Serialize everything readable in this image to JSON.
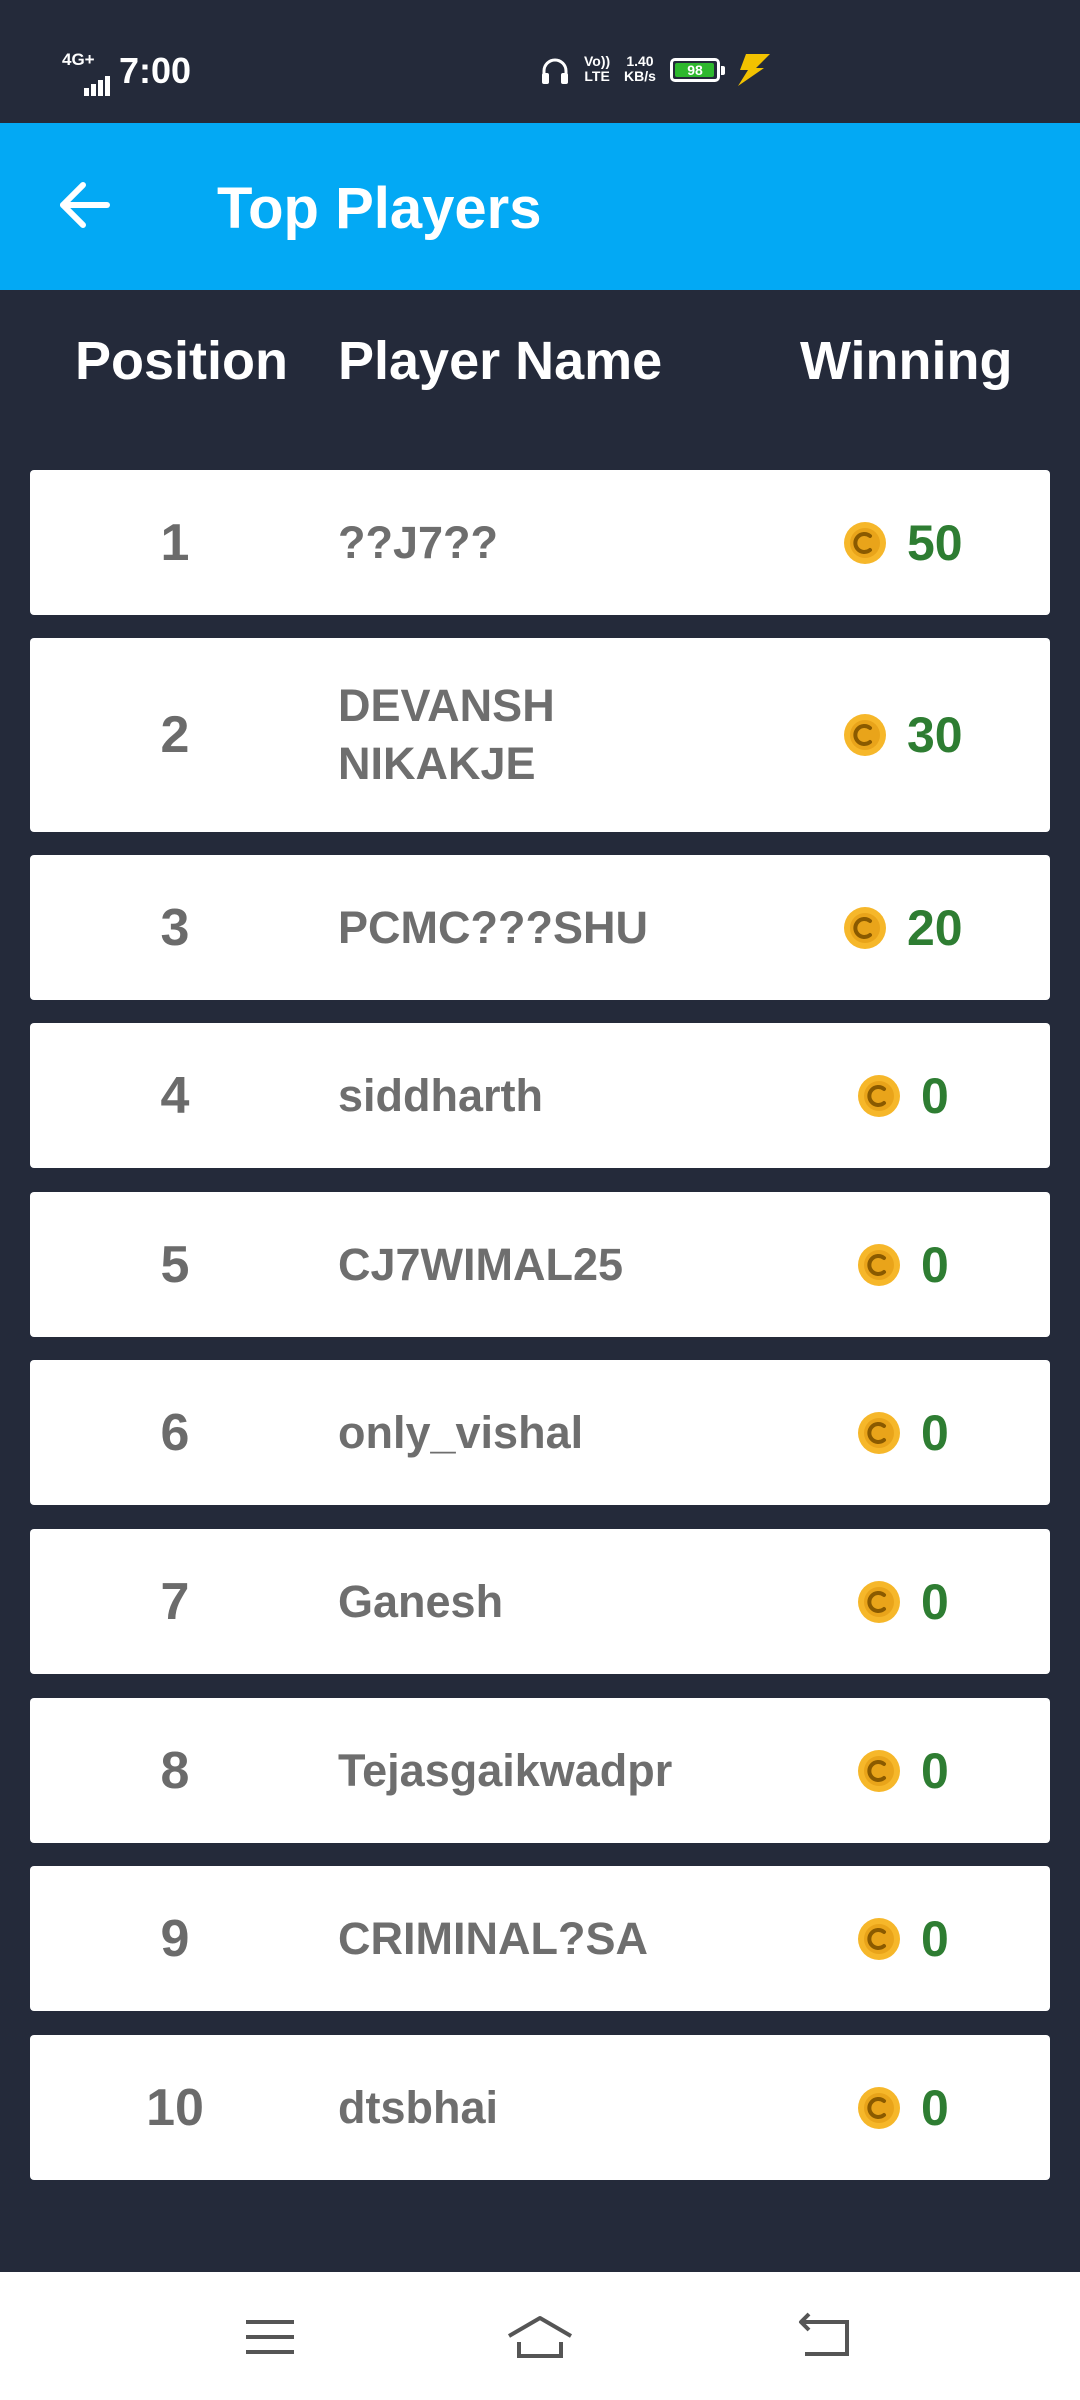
{
  "status_bar": {
    "network": "4G+",
    "time": "7:00",
    "volte_line1": "Vo))",
    "volte_line2": "LTE",
    "speed_value": "1.40",
    "speed_unit": "KB/s",
    "battery_percent": "98",
    "battery_level": 0.98
  },
  "app_bar": {
    "title": "Top Players"
  },
  "table": {
    "headers": {
      "position": "Position",
      "player_name": "Player Name",
      "winning": "Winning"
    },
    "rows": [
      {
        "position": "1",
        "name": "??J7??",
        "winning": "50"
      },
      {
        "position": "2",
        "name": "DEVANSH NIKAKJE",
        "winning": "30"
      },
      {
        "position": "3",
        "name": "PCMC???SHU",
        "winning": "20"
      },
      {
        "position": "4",
        "name": "siddharth",
        "winning": "0"
      },
      {
        "position": "5",
        "name": "CJ7WIMAL25",
        "winning": "0"
      },
      {
        "position": "6",
        "name": "only_vishal",
        "winning": "0"
      },
      {
        "position": "7",
        "name": "Ganesh",
        "winning": "0"
      },
      {
        "position": "8",
        "name": "Tejasgaikwadpr",
        "winning": "0"
      },
      {
        "position": "9",
        "name": "CRIMINAL?SA",
        "winning": "0"
      },
      {
        "position": "10",
        "name": "dtsbhai",
        "winning": "0"
      }
    ]
  },
  "colors": {
    "background": "#242a3a",
    "app_bar": "#03a9f4",
    "winning_text": "#2e7d32",
    "coin": "#f6b72a"
  },
  "icons": {
    "back": "arrow-left-icon",
    "coin": "coin-icon",
    "nav_menu": "menu-icon",
    "nav_home": "home-icon",
    "nav_back": "back-nav-icon"
  }
}
